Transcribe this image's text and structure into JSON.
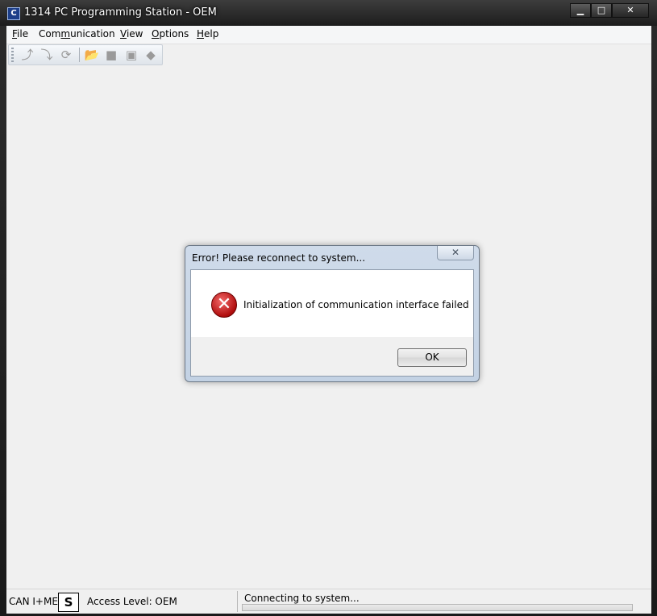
{
  "window": {
    "title": "1314 PC Programming Station - OEM",
    "app_icon_glyph": "C",
    "caption": {
      "minimize": "▁",
      "maximize": "□",
      "close": "✕"
    }
  },
  "menubar": {
    "items": [
      {
        "label": "File",
        "accel": "F",
        "rest": "ile"
      },
      {
        "label": "Communication",
        "accel": "m",
        "pre": "Com",
        "rest": "unication"
      },
      {
        "label": "View",
        "accel": "V",
        "rest": "iew"
      },
      {
        "label": "Options",
        "accel": "O",
        "rest": "ptions"
      },
      {
        "label": "Help",
        "accel": "H",
        "rest": "elp"
      }
    ]
  },
  "toolbar": {
    "buttons": [
      {
        "name": "connect-icon",
        "glyph": "⤴"
      },
      {
        "name": "disconnect-icon",
        "glyph": "⤵"
      },
      {
        "name": "refresh-icon",
        "glyph": "⟳"
      },
      {
        "name": "open-folder-icon",
        "glyph": "📂"
      },
      {
        "name": "stop-icon",
        "glyph": "■"
      },
      {
        "name": "program-icon",
        "glyph": "▣"
      },
      {
        "name": "diamond-icon",
        "glyph": "◆"
      }
    ]
  },
  "dialog": {
    "title": "Error! Please reconnect to system...",
    "close_glyph": "✕",
    "icon": "error-icon",
    "icon_glyph": "✕",
    "message": "Initialization of communication interface failed",
    "ok_label": "OK"
  },
  "statusbar": {
    "interface": "CAN I+ME",
    "mode_badge": "S",
    "access_level": "Access Level: OEM",
    "connection_status": "Connecting to system...",
    "progress": 0
  },
  "colors": {
    "window_frame": "#1c1c1c",
    "client_bg": "#f0f0f0",
    "error_red": "#b00d0d",
    "dialog_frame": "#c3d2e4"
  }
}
